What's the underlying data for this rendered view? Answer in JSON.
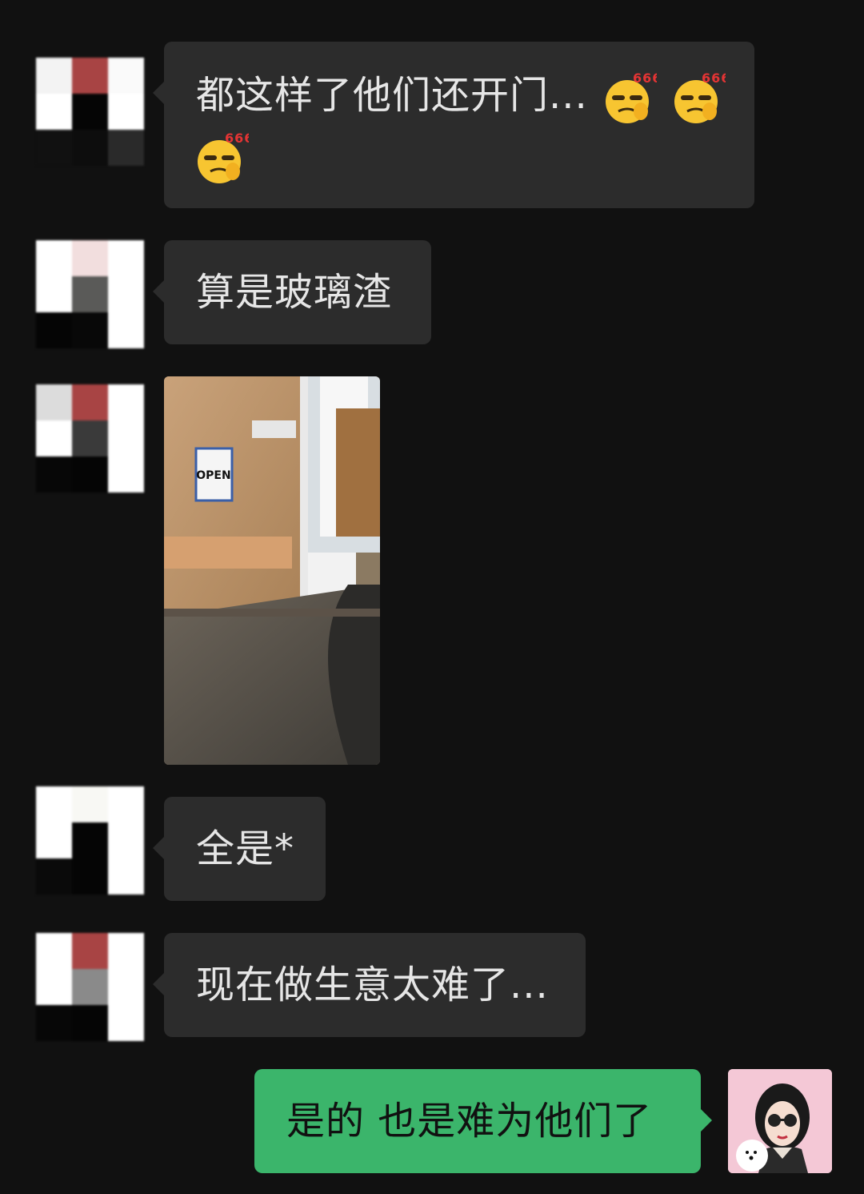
{
  "messages": [
    {
      "text": "都这样了他们还开门...",
      "emoji_name": "666-smirk-emoji",
      "emoji_badge": "666"
    },
    {
      "text": "算是玻璃渣"
    },
    {
      "photo_sign": "OPEN"
    },
    {
      "text": "全是*"
    },
    {
      "text": "现在做生意太难了..."
    },
    {
      "text": "是的 也是难为他们了"
    }
  ],
  "colors": {
    "background": "#111111",
    "bubble_in": "#2c2c2c",
    "bubble_out": "#3bb56b",
    "text_in": "#e6e6e6"
  }
}
